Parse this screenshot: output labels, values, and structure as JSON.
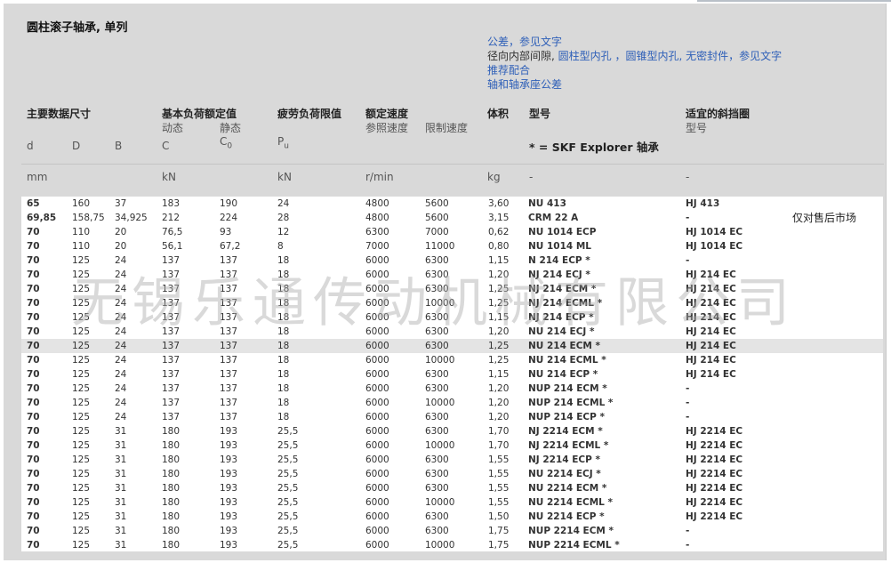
{
  "title": "圆柱滚子轴承, 单列",
  "info_links": {
    "line1": {
      "link": "公差",
      "rest": "，参见文字"
    },
    "line2": {
      "prefix": "径向内部间隙,",
      "link1": "圆柱型内孔",
      "link2": "圆锥型内孔, 无密封件",
      "rest": "，参见文字"
    },
    "line3": "推荐配合",
    "line4": "轴和轴承座公差"
  },
  "headers": {
    "main_dims": "主要数据尺寸",
    "basic_load": "基本负荷额定值",
    "dynamic": "动态",
    "static": "静态",
    "fatigue": "疲劳负荷限值",
    "speed": "额定速度",
    "ref_speed": "参照速度",
    "limit_speed": "限制速度",
    "mass": "体积",
    "designation": "型号",
    "explorer_note": "* = SKF Explorer 轴承",
    "ring": "适宜的斜挡圈",
    "ring_sub": "型号",
    "d": "d",
    "D": "D",
    "B": "B",
    "C": "C",
    "C0": "C",
    "C0_sub": "0",
    "Pu": "P",
    "Pu_sub": "u"
  },
  "units": {
    "mm": "mm",
    "kN1": "kN",
    "kN2": "kN",
    "rpm": "r/min",
    "kg": "kg",
    "dash1": "-",
    "dash2": "-"
  },
  "watermark": "无锡乐通传动机械有限公司",
  "highlight_row": 10,
  "rows": [
    [
      "65",
      "160",
      "37",
      "183",
      "190",
      "24",
      "4800",
      "5600",
      "3,60",
      "NU 413",
      "HJ 413",
      ""
    ],
    [
      "69,85",
      "158,75",
      "34,925",
      "212",
      "224",
      "28",
      "4800",
      "5600",
      "3,15",
      "CRM 22 A",
      "-",
      "仅对售后市场"
    ],
    [
      "70",
      "110",
      "20",
      "76,5",
      "93",
      "12",
      "6300",
      "7000",
      "0,62",
      "NU 1014 ECP",
      "HJ 1014 EC",
      ""
    ],
    [
      "70",
      "110",
      "20",
      "56,1",
      "67,2",
      "8",
      "7000",
      "11000",
      "0,80",
      "NU 1014 ML",
      "HJ 1014 EC",
      ""
    ],
    [
      "70",
      "125",
      "24",
      "137",
      "137",
      "18",
      "6000",
      "6300",
      "1,15",
      "N 214 ECP *",
      "-",
      ""
    ],
    [
      "70",
      "125",
      "24",
      "137",
      "137",
      "18",
      "6000",
      "6300",
      "1,20",
      "NJ 214 ECJ *",
      "HJ 214 EC",
      ""
    ],
    [
      "70",
      "125",
      "24",
      "137",
      "137",
      "18",
      "6000",
      "6300",
      "1,25",
      "NJ 214 ECM *",
      "HJ 214 EC",
      ""
    ],
    [
      "70",
      "125",
      "24",
      "137",
      "137",
      "18",
      "6000",
      "10000",
      "1,25",
      "NJ 214 ECML *",
      "HJ 214 EC",
      ""
    ],
    [
      "70",
      "125",
      "24",
      "137",
      "137",
      "18",
      "6000",
      "6300",
      "1,15",
      "NJ 214 ECP *",
      "HJ 214 EC",
      ""
    ],
    [
      "70",
      "125",
      "24",
      "137",
      "137",
      "18",
      "6000",
      "6300",
      "1,20",
      "NU 214 ECJ *",
      "HJ 214 EC",
      ""
    ],
    [
      "70",
      "125",
      "24",
      "137",
      "137",
      "18",
      "6000",
      "6300",
      "1,25",
      "NU 214 ECM *",
      "HJ 214 EC",
      ""
    ],
    [
      "70",
      "125",
      "24",
      "137",
      "137",
      "18",
      "6000",
      "10000",
      "1,25",
      "NU 214 ECML *",
      "HJ 214 EC",
      ""
    ],
    [
      "70",
      "125",
      "24",
      "137",
      "137",
      "18",
      "6000",
      "6300",
      "1,15",
      "NU 214 ECP *",
      "HJ 214 EC",
      ""
    ],
    [
      "70",
      "125",
      "24",
      "137",
      "137",
      "18",
      "6000",
      "6300",
      "1,20",
      "NUP 214 ECM *",
      "-",
      ""
    ],
    [
      "70",
      "125",
      "24",
      "137",
      "137",
      "18",
      "6000",
      "10000",
      "1,20",
      "NUP 214 ECML *",
      "-",
      ""
    ],
    [
      "70",
      "125",
      "24",
      "137",
      "137",
      "18",
      "6000",
      "6300",
      "1,20",
      "NUP 214 ECP *",
      "-",
      ""
    ],
    [
      "70",
      "125",
      "31",
      "180",
      "193",
      "25,5",
      "6000",
      "6300",
      "1,70",
      "NJ 2214 ECM *",
      "HJ 2214 EC",
      ""
    ],
    [
      "70",
      "125",
      "31",
      "180",
      "193",
      "25,5",
      "6000",
      "10000",
      "1,70",
      "NJ 2214 ECML *",
      "HJ 2214 EC",
      ""
    ],
    [
      "70",
      "125",
      "31",
      "180",
      "193",
      "25,5",
      "6000",
      "6300",
      "1,55",
      "NJ 2214 ECP *",
      "HJ 2214 EC",
      ""
    ],
    [
      "70",
      "125",
      "31",
      "180",
      "193",
      "25,5",
      "6000",
      "6300",
      "1,55",
      "NU 2214 ECJ *",
      "HJ 2214 EC",
      ""
    ],
    [
      "70",
      "125",
      "31",
      "180",
      "193",
      "25,5",
      "6000",
      "6300",
      "1,55",
      "NU 2214 ECM *",
      "HJ 2214 EC",
      ""
    ],
    [
      "70",
      "125",
      "31",
      "180",
      "193",
      "25,5",
      "6000",
      "10000",
      "1,55",
      "NU 2214 ECML *",
      "HJ 2214 EC",
      ""
    ],
    [
      "70",
      "125",
      "31",
      "180",
      "193",
      "25,5",
      "6000",
      "6300",
      "1,50",
      "NU 2214 ECP *",
      "HJ 2214 EC",
      ""
    ],
    [
      "70",
      "125",
      "31",
      "180",
      "193",
      "25,5",
      "6000",
      "6300",
      "1,75",
      "NUP 2214 ECM *",
      "-",
      ""
    ],
    [
      "70",
      "125",
      "31",
      "180",
      "193",
      "25,5",
      "6000",
      "10000",
      "1,75",
      "NUP 2214 ECML *",
      "-",
      ""
    ]
  ]
}
